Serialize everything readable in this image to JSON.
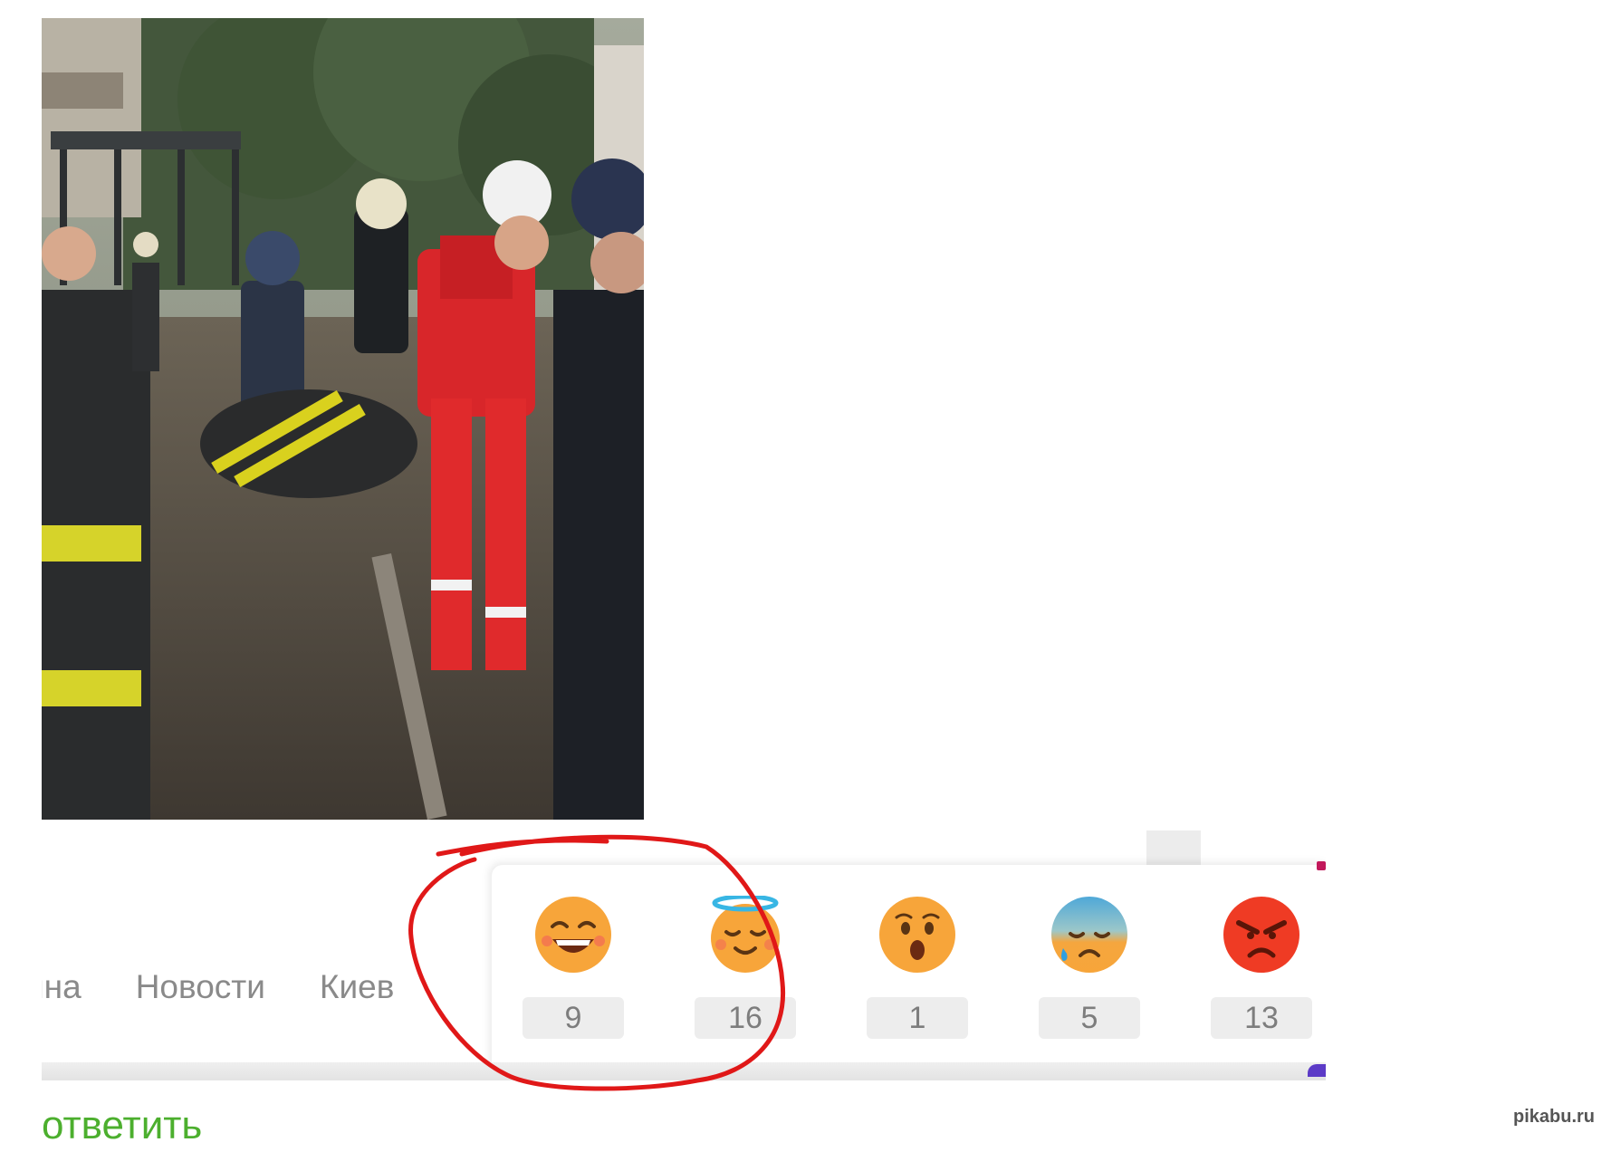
{
  "post": {
    "tags": [
      "ина",
      "Новости",
      "Киев"
    ]
  },
  "reactions": [
    {
      "icon": "laughing-face-icon",
      "count": "9"
    },
    {
      "icon": "halo-face-icon",
      "count": "16"
    },
    {
      "icon": "surprised-face-icon",
      "count": "1"
    },
    {
      "icon": "sad-sweat-face-icon",
      "count": "5"
    },
    {
      "icon": "angry-face-icon",
      "count": "13"
    }
  ],
  "annotation": {
    "color": "#e01818"
  },
  "comment": {
    "reply_label": "ответить"
  },
  "watermark": "pikabu.ru"
}
